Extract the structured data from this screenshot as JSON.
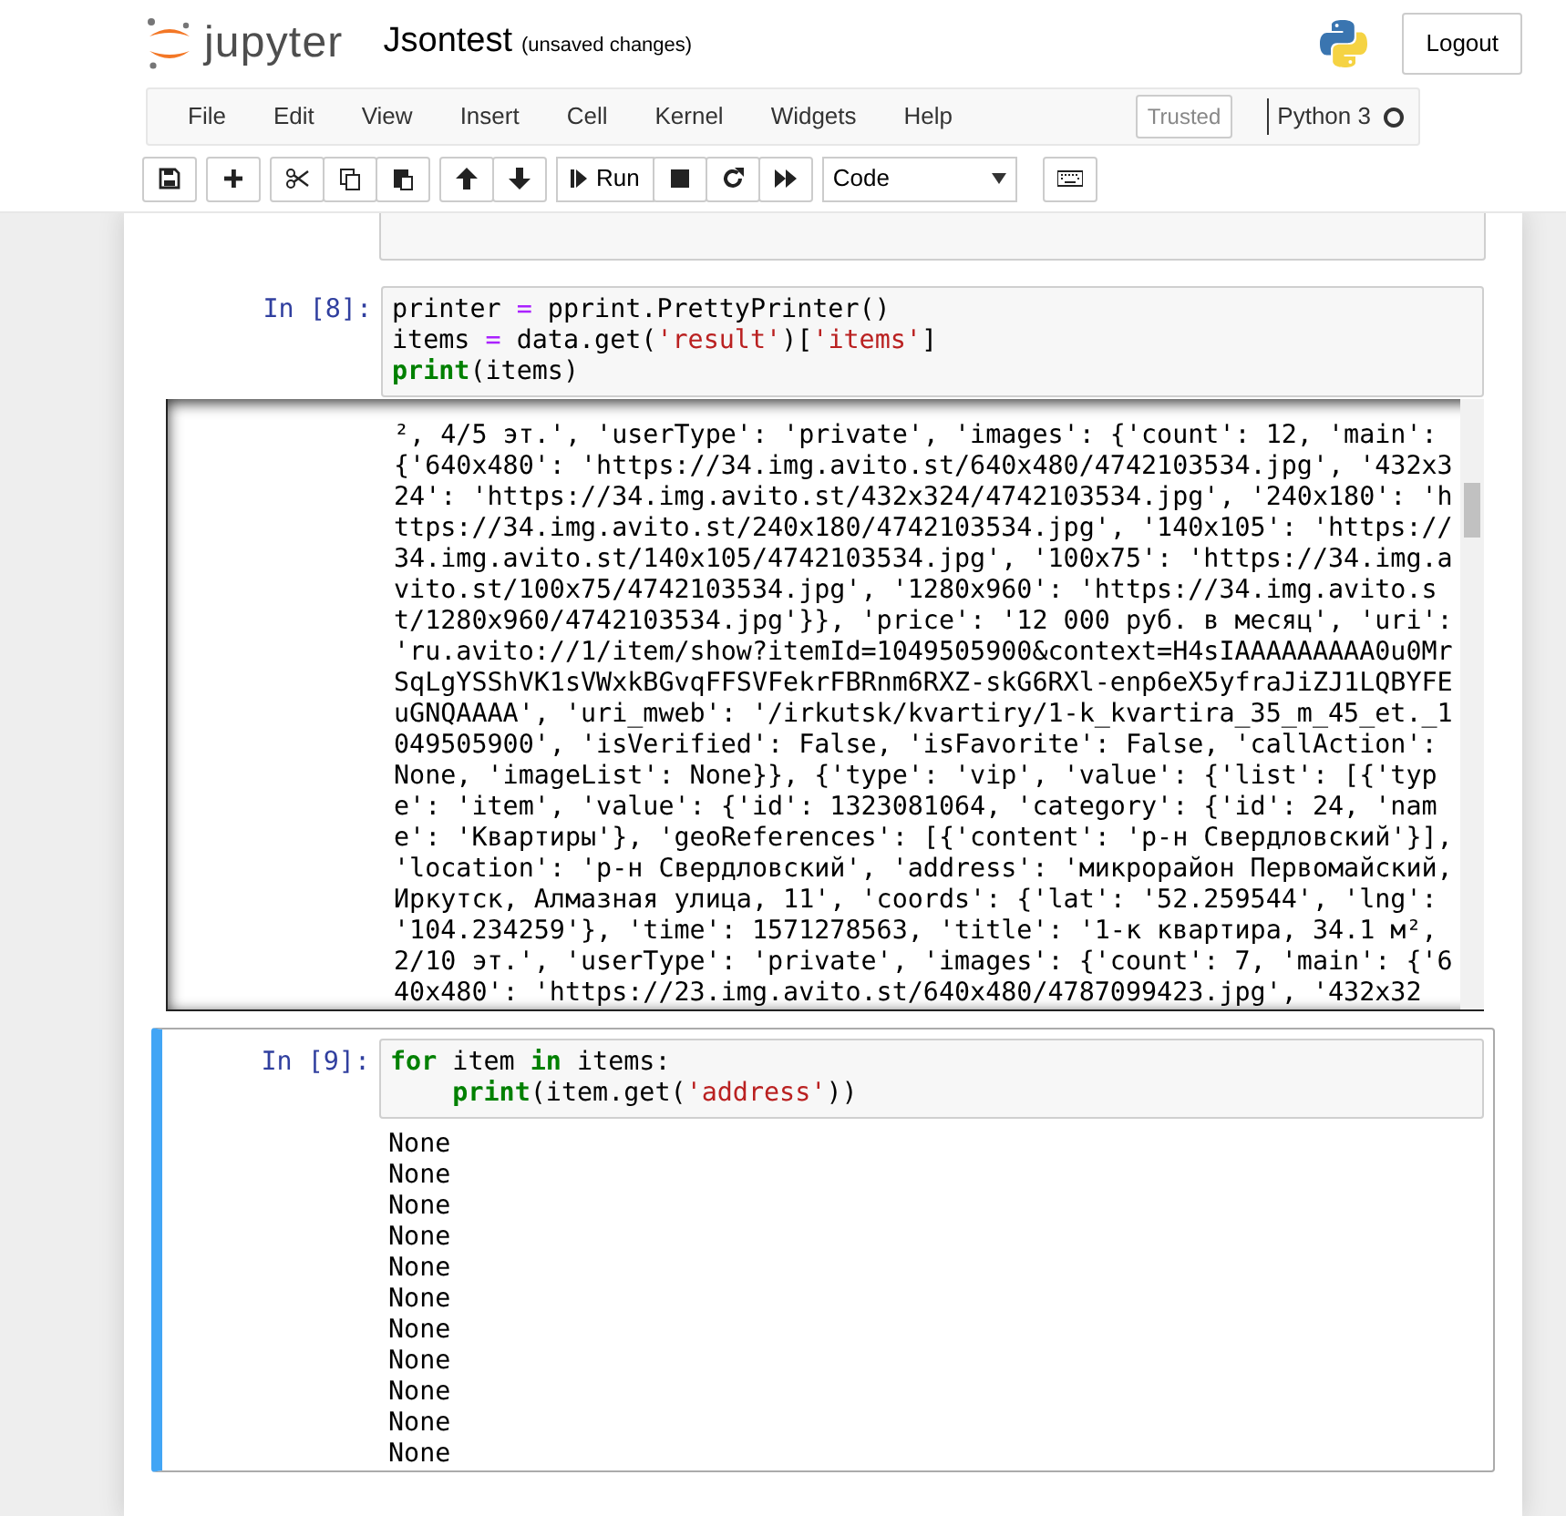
{
  "header": {
    "logo_text": "jupyter",
    "notebook_name": "Jsontest",
    "save_status": "(unsaved changes)",
    "logout": "Logout"
  },
  "menu": {
    "items": [
      "File",
      "Edit",
      "View",
      "Insert",
      "Cell",
      "Kernel",
      "Widgets",
      "Help"
    ],
    "trusted": "Trusted",
    "kernel_name": "Python 3",
    "kernel_busy": false
  },
  "toolbar": {
    "run_label": "Run",
    "cell_type": "Code"
  },
  "cells": [
    {
      "prompt": "In [8]:",
      "selected": false,
      "code": [
        "printer = pprint.PrettyPrinter()",
        "items = data.get('result')['items']",
        "print(items)"
      ],
      "scrolled_output": true,
      "output": [
        "², 4/5 эт.', 'userType': 'private', 'images': {'count': 12, 'main':",
        "{'640x480': 'https://34.img.avito.st/640x480/4742103534.jpg', '432x3",
        "24': 'https://34.img.avito.st/432x324/4742103534.jpg', '240x180': 'h",
        "ttps://34.img.avito.st/240x180/4742103534.jpg', '140x105': 'https://",
        "34.img.avito.st/140x105/4742103534.jpg', '100x75': 'https://34.img.a",
        "vito.st/100x75/4742103534.jpg', '1280x960': 'https://34.img.avito.s",
        "t/1280x960/4742103534.jpg'}}, 'price': '12 000 руб. в месяц', 'uri':",
        "'ru.avito://1/item/show?itemId=1049505900&context=H4sIAAAAAAAAA0u0Mr",
        "SqLgYSShVK1sVWxkBGvqFFSVFekrFBRnm6RXZ-skG6RXl-enp6eX5yfraJiZJ1LQBYFE",
        "uGNQAAAA', 'uri_mweb': '/irkutsk/kvartiry/1-k_kvartira_35_m_45_et._1",
        "049505900', 'isVerified': False, 'isFavorite': False, 'callAction':",
        "None, 'imageList': None}}, {'type': 'vip', 'value': {'list': [{'typ",
        "e': 'item', 'value': {'id': 1323081064, 'category': {'id': 24, 'nam",
        "e': 'Квартиры'}, 'geoReferences': [{'content': 'р-н Свердловский'}],",
        "'location': 'р-н Свердловский', 'address': 'микрорайон Первомайский,",
        "Иркутск, Алмазная улица, 11', 'coords': {'lat': '52.259544', 'lng':",
        "'104.234259'}, 'time': 1571278563, 'title': '1-к квартира, 34.1 м²,",
        "2/10 эт.', 'userType': 'private', 'images': {'count': 7, 'main': {'6",
        "40x480': 'https://23.img.avito.st/640x480/4787099423.jpg', '432x32"
      ]
    },
    {
      "prompt": "In [9]:",
      "selected": true,
      "code": [
        "for item in items:",
        "    print(item.get('address'))"
      ],
      "scrolled_output": false,
      "output": [
        "None",
        "None",
        "None",
        "None",
        "None",
        "None",
        "None",
        "None",
        "None",
        "None",
        "None"
      ]
    }
  ]
}
